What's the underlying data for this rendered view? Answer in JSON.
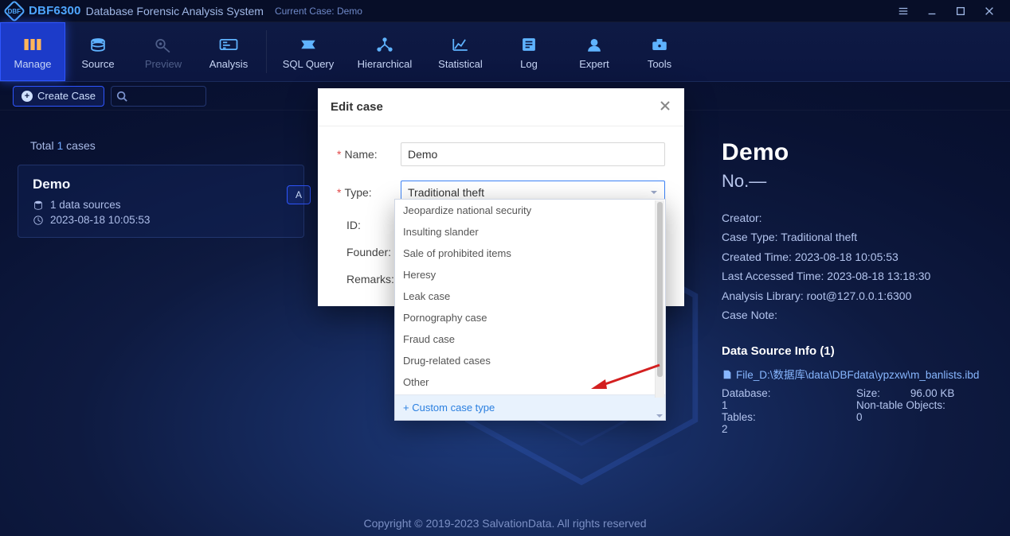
{
  "titlebar": {
    "brand_short": "DBF",
    "brand_name": "DBF6300",
    "brand_desc": "Database Forensic Analysis System",
    "current_case_label": "Current Case: Demo"
  },
  "toolbar": {
    "items": [
      {
        "label": "Manage"
      },
      {
        "label": "Source"
      },
      {
        "label": "Preview"
      },
      {
        "label": "Analysis"
      },
      {
        "label": "SQL Query"
      },
      {
        "label": "Hierarchical"
      },
      {
        "label": "Statistical"
      },
      {
        "label": "Log"
      },
      {
        "label": "Expert"
      },
      {
        "label": "Tools"
      }
    ]
  },
  "subbar": {
    "create_label": "Create Case"
  },
  "left": {
    "total_prefix": "Total ",
    "total_count": "1",
    "total_suffix": " cases",
    "card": {
      "name": "Demo",
      "sources": "1 data sources",
      "ts": "2023-08-18 10:05:53"
    },
    "btn_a": "A"
  },
  "right": {
    "title": "Demo",
    "no_line": "No.—",
    "creator_label": "Creator:",
    "casetype": "Case Type: Traditional theft",
    "created": "Created Time: 2023-08-18 10:05:53",
    "accessed": "Last Accessed Time: 2023-08-18 13:18:30",
    "library": "Analysis Library: root@127.0.0.1:6300",
    "note": "Case Note:",
    "ds_head": "Data Source Info (1)",
    "ds_path": "File_D:\\数据库\\data\\DBFdata\\ypzxw\\m_banlists.ibd",
    "ds_stats": {
      "db_label": "Database:",
      "db_val": "1",
      "size_label": "Size:",
      "size_val": "96.00 KB",
      "tables_label": "Tables:",
      "tables_val": "2",
      "nto_label": "Non-table Objects:",
      "nto_val": "0"
    }
  },
  "modal": {
    "title": "Edit case",
    "name_label": "Name:",
    "name_value": "Demo",
    "type_label": "Type:",
    "type_value": "Traditional theft",
    "id_label": "ID:",
    "founder_label": "Founder:",
    "remarks_label": "Remarks:"
  },
  "dropdown": {
    "items": [
      "Jeopardize national security",
      "Insulting slander",
      "Sale of prohibited items",
      "Heresy",
      "Leak case",
      "Pornography case",
      "Fraud case",
      "Drug-related cases",
      "Other"
    ],
    "add_label": "+ Custom case type"
  },
  "footer": {
    "copy": "Copyright © 2019-2023  SalvationData. All rights reserved"
  }
}
